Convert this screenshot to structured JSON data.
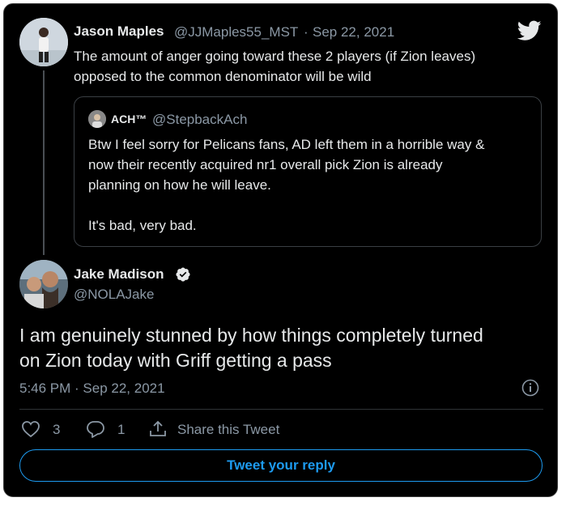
{
  "parent_tweet": {
    "author_name": "Jason Maples",
    "handle": "@JJMaples55_MST",
    "separator": "·",
    "date": "Sep 22, 2021",
    "text_line1": "The amount of anger going toward these 2 players (if Zion leaves)",
    "text_line2": "opposed to the common denominator will be wild"
  },
  "quoted_tweet": {
    "author_name": "ACH™",
    "handle": "@StepbackAch",
    "line1": "Btw I feel sorry for Pelicans fans, AD left them in a horrible way &",
    "line2": "now their recently acquired nr1 overall pick Zion is already",
    "line3": "planning on how he will leave.",
    "line4": "It's bad, very bad."
  },
  "main_tweet": {
    "author_name": "Jake Madison",
    "handle": "@NOLAJake",
    "text_line1": "I am genuinely stunned by how things completely turned",
    "text_line2": "on Zion today with Griff getting a pass",
    "timestamp": "5:46 PM · Sep 22, 2021"
  },
  "actions": {
    "like_count": "3",
    "reply_count": "1",
    "share_label": "Share this Tweet"
  },
  "reply_button_label": "Tweet your reply",
  "colors": {
    "background": "#000000",
    "text": "#e7e9ea",
    "muted": "#8b98a5",
    "accent": "#1d9bf0"
  }
}
